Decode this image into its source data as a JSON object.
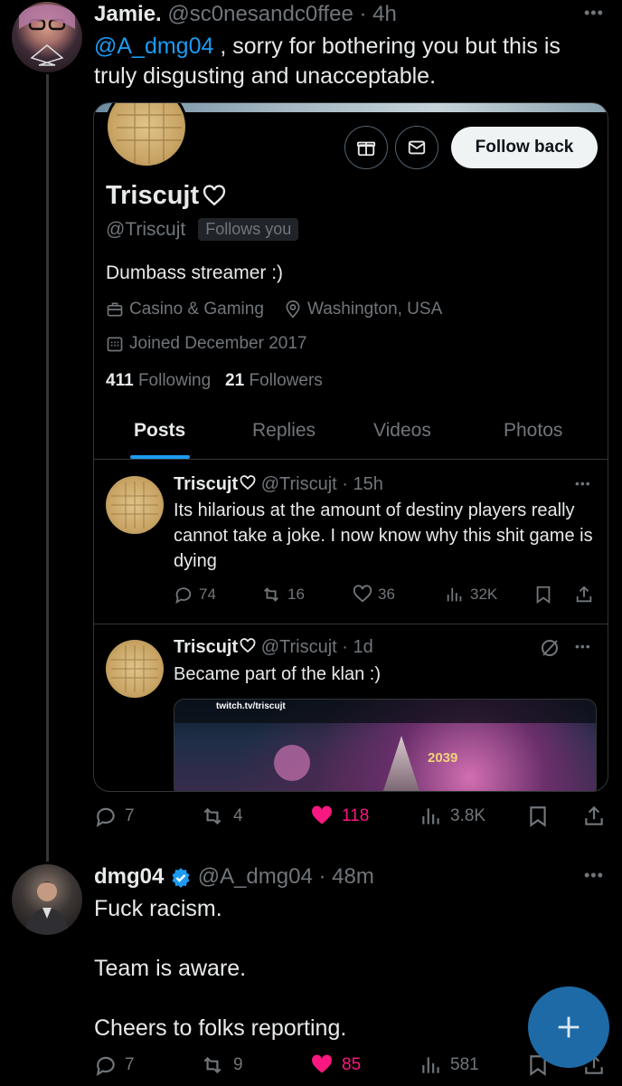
{
  "tweet1": {
    "name": "Jamie.",
    "handle": "@sc0nesandc0ffee",
    "time": "4h",
    "mention": "@A_dmg04",
    "text": " , sorry for bothering you but this is truly disgusting and unacceptable.",
    "actions": {
      "replies": "7",
      "reposts": "4",
      "likes": "118",
      "views": "3.8K"
    }
  },
  "quoted_profile": {
    "follow_back_label": "Follow back",
    "name": "Triscujt",
    "handle": "@Triscujt",
    "follows_you": "Follows you",
    "bio": "Dumbass streamer :)",
    "category": "Casino & Gaming",
    "location": "Washington, USA",
    "joined": "Joined December 2017",
    "following_count": "411",
    "following_label": "Following",
    "followers_count": "21",
    "followers_label": "Followers",
    "tabs": [
      "Posts",
      "Replies",
      "Videos",
      "Photos"
    ],
    "posts": [
      {
        "name": "Triscujt",
        "handle": "@Triscujt",
        "time": "15h",
        "text": "Its hilarious at the amount of destiny players really cannot take a joke. I now know why this shit game is dying",
        "replies": "74",
        "reposts": "16",
        "likes": "36",
        "views": "32K"
      },
      {
        "name": "Triscujt",
        "handle": "@Triscujt",
        "time": "1d",
        "text": "Became part of the klan :)",
        "media_url_text": "twitch.tv/triscujt",
        "media_power": "2039"
      }
    ]
  },
  "tweet2": {
    "name": "dmg04",
    "handle": "@A_dmg04",
    "time": "48m",
    "line1": "Fuck racism.",
    "line2": "Team is aware.",
    "line3": "Cheers to folks reporting.",
    "actions": {
      "replies": "7",
      "reposts": "9",
      "likes": "85",
      "views": "581"
    }
  },
  "colors": {
    "accent": "#1d9bf0",
    "like": "#f91880",
    "muted": "#71767b",
    "background": "#000000"
  }
}
